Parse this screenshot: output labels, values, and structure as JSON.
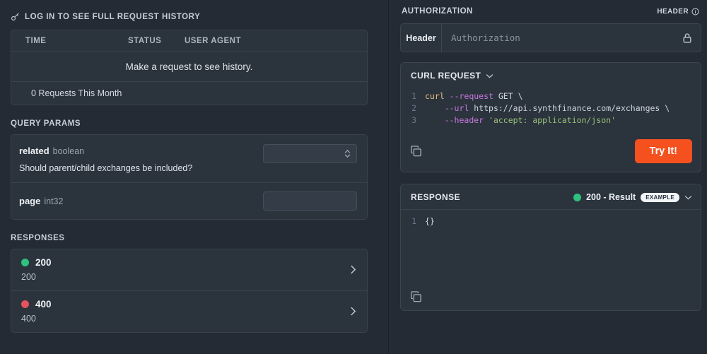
{
  "history": {
    "title": "LOG IN TO SEE FULL REQUEST HISTORY",
    "key_icon": "key-icon",
    "columns": [
      "TIME",
      "STATUS",
      "USER AGENT"
    ],
    "empty_text": "Make a request to see history.",
    "footer": "0 Requests This Month"
  },
  "query_params": {
    "title": "QUERY PARAMS",
    "params": [
      {
        "name": "related",
        "type": "boolean",
        "description": "Should parent/child exchanges be included?",
        "value": "",
        "control": "select"
      },
      {
        "name": "page",
        "type": "int32",
        "description": "",
        "value": "",
        "control": "text"
      }
    ]
  },
  "responses": {
    "title": "RESPONSES",
    "items": [
      {
        "code": "200",
        "label": "200",
        "dot_color": "#2ec27e",
        "chevron": "chevron-right-icon"
      },
      {
        "code": "400",
        "label": "400",
        "dot_color": "#e5535b",
        "chevron": "chevron-right-icon"
      }
    ]
  },
  "authorization": {
    "title": "AUTHORIZATION",
    "location_label": "HEADER",
    "info_icon": "info-icon",
    "key_label": "Header",
    "value_placeholder": "Authorization",
    "lock_icon": "lock-icon"
  },
  "curl": {
    "title": "CURL REQUEST",
    "chevron": "chevron-down-icon",
    "copy_icon": "copy-icon",
    "try_label": "Try It!",
    "lines": [
      {
        "n": "1",
        "cmd": "curl",
        "flag": "--request",
        "plain": " GET \\"
      },
      {
        "n": "2",
        "indent": "    ",
        "flag": "--url",
        "plain": " https://api.synthfinance.com/exchanges \\"
      },
      {
        "n": "3",
        "indent": "    ",
        "flag": "--header",
        "str": " 'accept: application/json'"
      }
    ]
  },
  "response_panel": {
    "title": "RESPONSE",
    "status": "200 - Result",
    "badge": "EXAMPLE",
    "dot_color": "#2ec27e",
    "chevron": "chevron-down-icon",
    "copy_icon": "copy-icon",
    "body_line_number": "1",
    "body": "{}"
  }
}
